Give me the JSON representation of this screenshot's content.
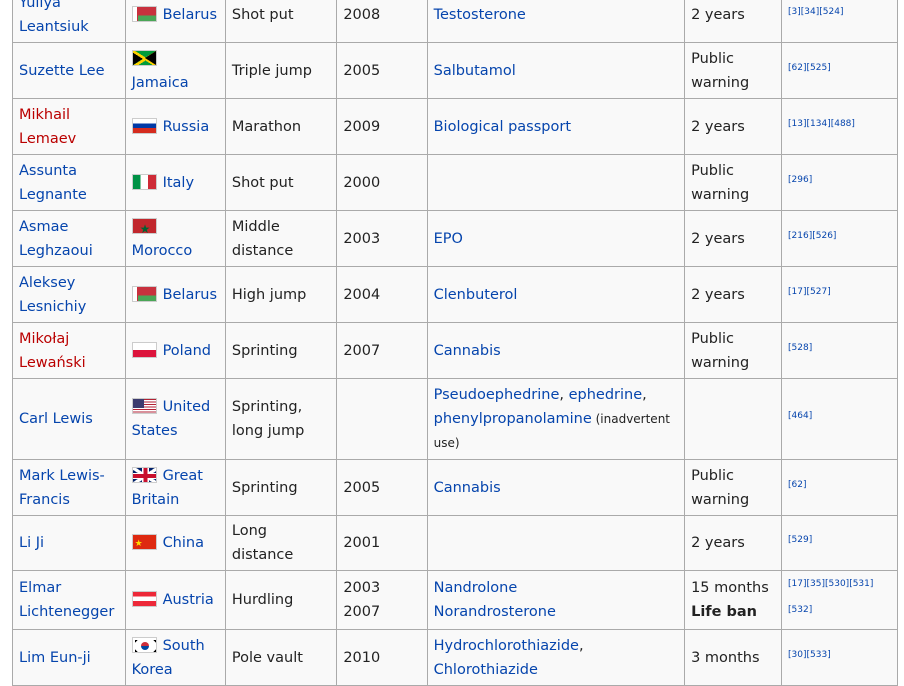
{
  "rows": [
    {
      "name": "Yuliya Leantsiuk",
      "name_red": false,
      "flag": "f-by",
      "country": "Belarus",
      "event": "Shot put",
      "years": [
        "2008"
      ],
      "substances": [
        {
          "text": "Testosterone",
          "link": true
        }
      ],
      "sanctions": [
        {
          "text": "2 years",
          "bold": false
        }
      ],
      "refs": "[3][34][524]",
      "h": 56
    },
    {
      "name": "Suzette Lee",
      "name_red": false,
      "flag": "f-jm",
      "country": "Jamaica",
      "event": "Triple jump",
      "years": [
        "2005"
      ],
      "substances": [
        {
          "text": "Salbutamol",
          "link": true
        }
      ],
      "sanctions": [
        {
          "text": "Public warning",
          "bold": false
        }
      ],
      "refs": "[62][525]",
      "h": 56
    },
    {
      "name": "Mikhail Lemaev",
      "name_red": true,
      "flag": "f-ru",
      "country": "Russia",
      "event": "Marathon",
      "years": [
        "2009"
      ],
      "substances": [
        {
          "text": "Biological passport",
          "link": true
        }
      ],
      "sanctions": [
        {
          "text": "2 years",
          "bold": false
        }
      ],
      "refs": "[13][134][488]",
      "h": 56
    },
    {
      "name": "Assunta Legnante",
      "name_red": false,
      "flag": "f-it",
      "country": "Italy",
      "event": "Shot put",
      "years": [
        "2000"
      ],
      "substances": [],
      "sanctions": [
        {
          "text": "Public warning",
          "bold": false
        }
      ],
      "refs": "[296]",
      "h": 56
    },
    {
      "name": "Asmae Leghzaoui",
      "name_red": false,
      "flag": "f-ma",
      "country": "Morocco",
      "event": "Middle distance",
      "years": [
        "2003"
      ],
      "substances": [
        {
          "text": "EPO",
          "link": true
        }
      ],
      "sanctions": [
        {
          "text": "2 years",
          "bold": false
        }
      ],
      "refs": "[216][526]",
      "h": 56
    },
    {
      "name": "Aleksey Lesnichiy",
      "name_red": false,
      "flag": "f-by",
      "country": "Belarus",
      "event": "High jump",
      "years": [
        "2004"
      ],
      "substances": [
        {
          "text": "Clenbuterol",
          "link": true
        }
      ],
      "sanctions": [
        {
          "text": "2 years",
          "bold": false
        }
      ],
      "refs": "[17][527]",
      "h": 56
    },
    {
      "name": "Mikołaj Lewański",
      "name_red": true,
      "flag": "f-pl",
      "country": "Poland",
      "event": "Sprinting",
      "years": [
        "2007"
      ],
      "substances": [
        {
          "text": "Cannabis",
          "link": true
        }
      ],
      "sanctions": [
        {
          "text": "Public warning",
          "bold": false
        }
      ],
      "refs": "[528]",
      "h": 56
    },
    {
      "name": "Carl Lewis",
      "name_red": false,
      "flag": "f-us",
      "country": "United States",
      "event": "Sprinting, long jump",
      "years": [],
      "substances": [
        {
          "text": "Pseudoephedrine",
          "link": true
        },
        {
          "text": ", ",
          "link": false
        },
        {
          "text": "ephedrine",
          "link": true
        },
        {
          "text": ", ",
          "link": false
        },
        {
          "text": "phenylpropanolamine",
          "link": true
        },
        {
          "text": " (inadvertent use)",
          "link": false,
          "small": true
        }
      ],
      "sanctions": [],
      "refs": "[464]",
      "h": 81
    },
    {
      "name": "Mark Lewis-Francis",
      "name_red": false,
      "flag": "f-gb",
      "country": "Great Britain",
      "event": "Sprinting",
      "years": [
        "2005"
      ],
      "substances": [
        {
          "text": "Cannabis",
          "link": true
        }
      ],
      "sanctions": [
        {
          "text": "Public warning",
          "bold": false
        }
      ],
      "refs": "[62]",
      "h": 56
    },
    {
      "name": "Li Ji",
      "name_red": false,
      "flag": "f-cn",
      "country": "China",
      "event": "Long distance",
      "years": [
        "2001"
      ],
      "substances": [],
      "sanctions": [
        {
          "text": "2 years",
          "bold": false
        }
      ],
      "refs": "[529]",
      "h": 32
    },
    {
      "name": "Elmar Lichtenegger",
      "name_red": false,
      "flag": "f-at",
      "country": "Austria",
      "event": "Hurdling",
      "years": [
        "2003",
        "2007"
      ],
      "substances": [
        {
          "text": "Nandrolone",
          "link": true,
          "br": true
        },
        {
          "text": "Norandrosterone",
          "link": true
        }
      ],
      "sanctions": [
        {
          "text": "15 months",
          "bold": false
        },
        {
          "text": "Life ban",
          "bold": true
        }
      ],
      "refs": "[17][35][530][531][532]",
      "h": 56
    },
    {
      "name": "Lim Eun-ji",
      "name_red": false,
      "flag": "f-kr",
      "country": "South Korea",
      "event": "Pole vault",
      "years": [
        "2010"
      ],
      "substances": [
        {
          "text": "Hydrochlorothiazide",
          "link": true
        },
        {
          "text": ", ",
          "link": false
        },
        {
          "text": "Chlorothiazide",
          "link": true
        }
      ],
      "sanctions": [
        {
          "text": "3 months",
          "bold": false
        }
      ],
      "refs": "[30][533]",
      "h": 56
    }
  ]
}
